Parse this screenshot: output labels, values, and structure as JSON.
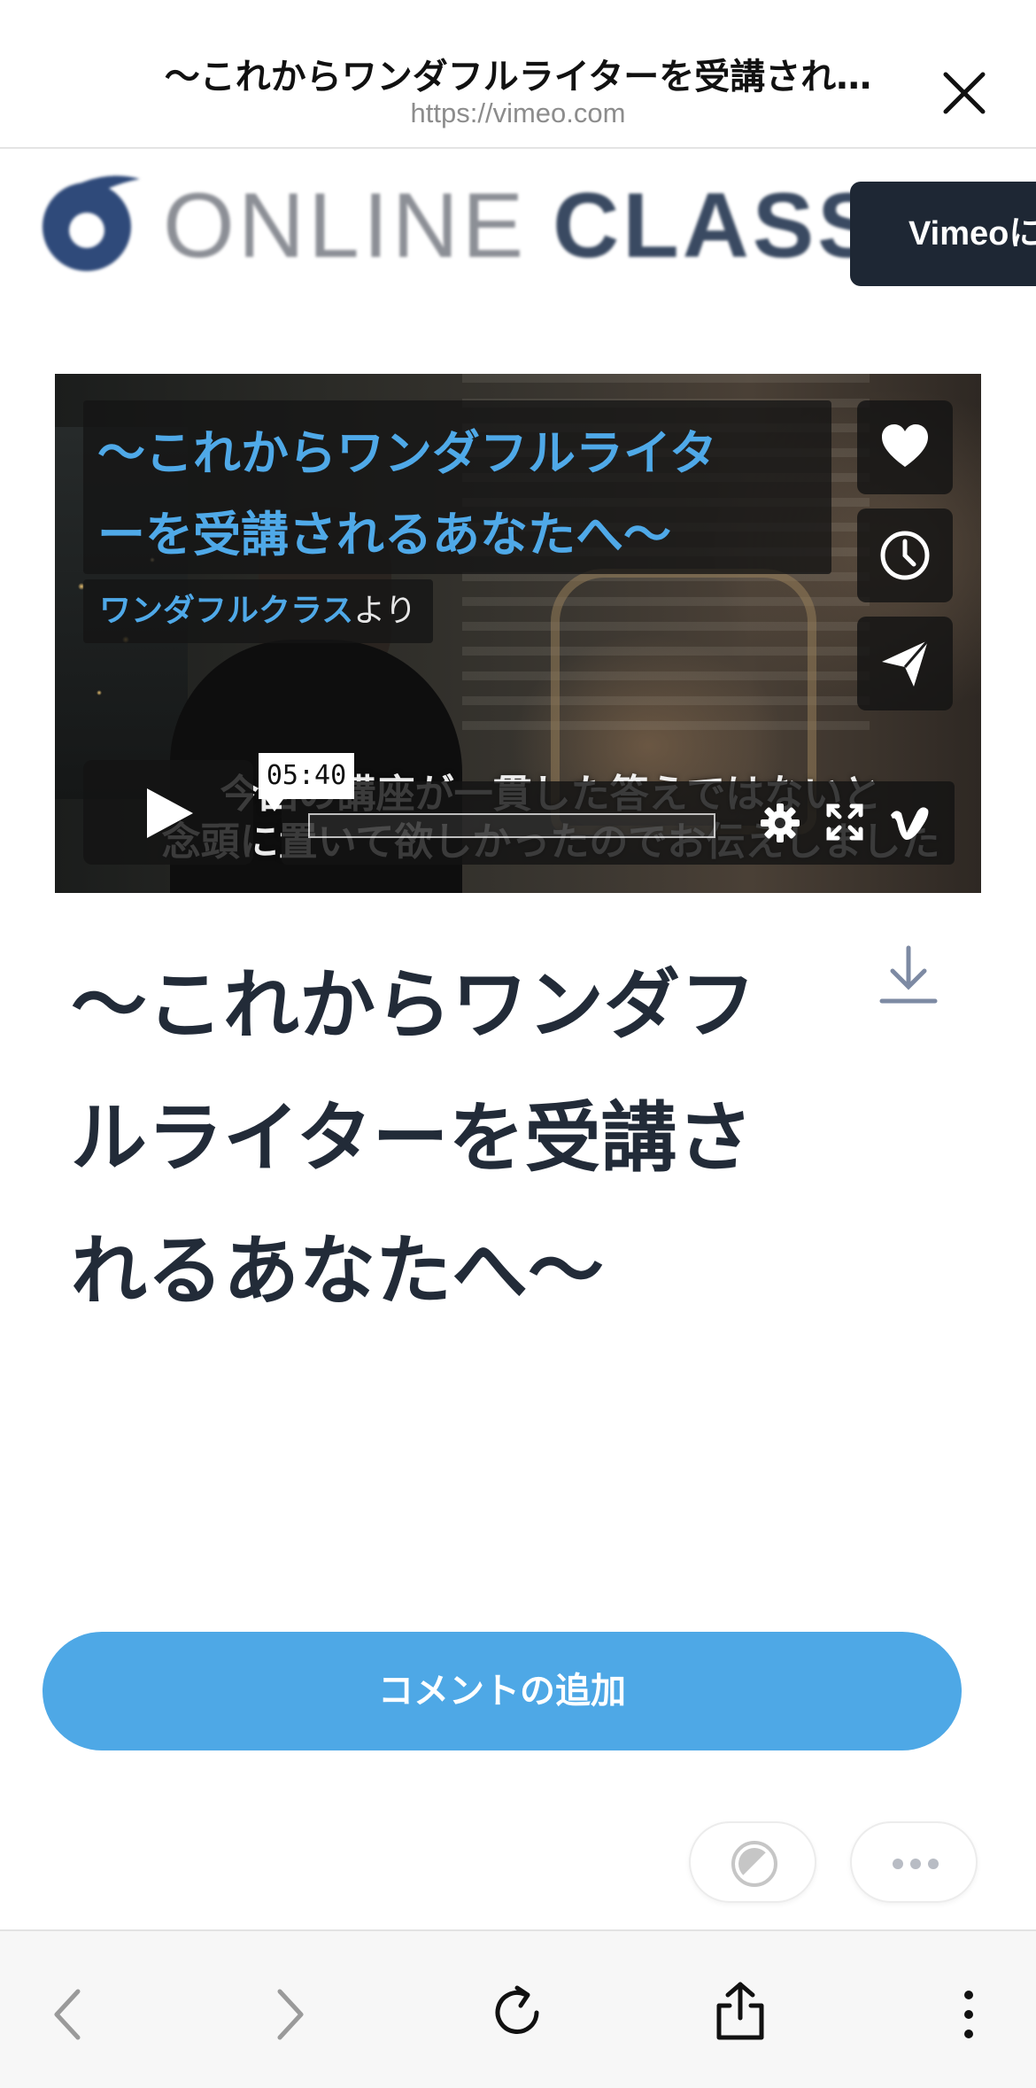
{
  "header": {
    "title": "〜これからワンダフルライターを受講され…",
    "url": "https://vimeo.com"
  },
  "logo": {
    "word_thin": "ONLINE",
    "word_bold": "CLASS"
  },
  "banner": {
    "label": "Vimeoに"
  },
  "video": {
    "title_line1": "〜これからワンダフルライタ",
    "title_line2": "ーを受講されるあなたへ〜",
    "author": "ワンダフルクラス",
    "author_suffix": "より",
    "subtitle_line1": "今回の講座が一貫した答えではないと",
    "subtitle_line2": "念頭に置いて欲しかったのでお伝えしました",
    "duration": "05:40",
    "progress": 0
  },
  "main": {
    "title": "〜これからワンダフルライターを受講されるあなたへ〜",
    "comment_button": "コメントの追加"
  },
  "colors": {
    "accent": "#4ea8e6",
    "title_text": "#222b38",
    "banner_bg": "#1e2734"
  },
  "icons": [
    "close-icon",
    "heart-icon",
    "clock-icon",
    "send-icon",
    "play-icon",
    "gear-icon",
    "fullscreen-icon",
    "vimeo-icon",
    "download-icon",
    "contrast-icon",
    "more-icon",
    "back-icon",
    "forward-icon",
    "reload-icon",
    "share-icon",
    "menu-icon"
  ]
}
